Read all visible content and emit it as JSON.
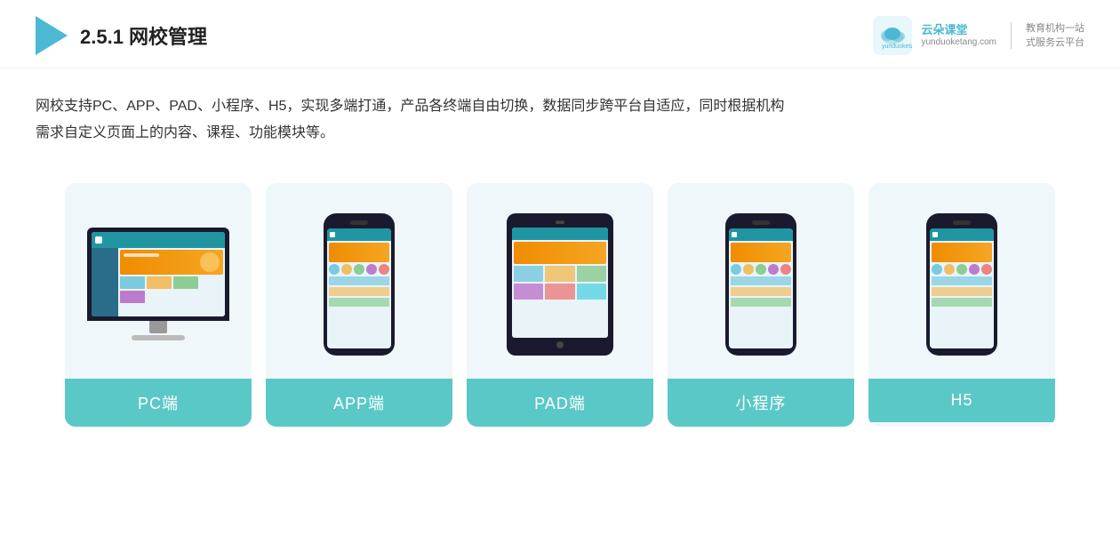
{
  "header": {
    "title_prefix": "2.5.1 ",
    "title_main": "网校管理",
    "brand": {
      "name": "云朵课堂",
      "pinyin": "yunduoketang.com",
      "slogan_line1": "教育机构一站",
      "slogan_line2": "式服务云平台"
    }
  },
  "description": {
    "line1": "网校支持PC、APP、PAD、小程序、H5，实现多端打通，产品各终端自由切换，数据同步跨平台自适应，同时根据机构",
    "line2": "需求自定义页面上的内容、课程、功能模块等。"
  },
  "cards": [
    {
      "id": "pc",
      "label": "PC端"
    },
    {
      "id": "app",
      "label": "APP端"
    },
    {
      "id": "pad",
      "label": "PAD端"
    },
    {
      "id": "miniapp",
      "label": "小程序"
    },
    {
      "id": "h5",
      "label": "H5"
    }
  ]
}
